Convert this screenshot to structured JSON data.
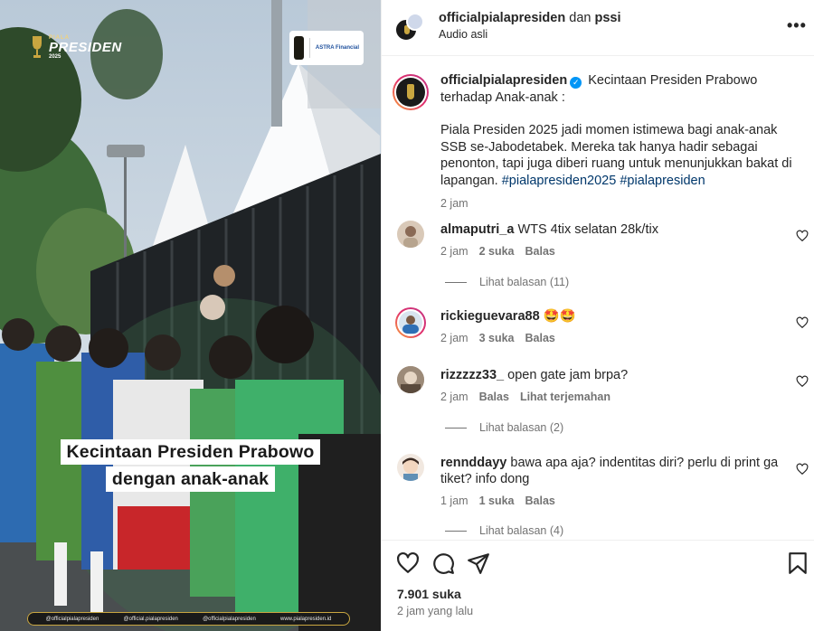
{
  "media": {
    "brand_small": "PIALA",
    "brand_big": "PRESIDEN",
    "brand_year": "2025",
    "sponsor_text": "ASTRA Financial",
    "caption_line1": "Kecintaan Presiden Prabowo",
    "caption_line2": "dengan anak-anak",
    "social": [
      "@officialpialapresiden",
      "@official.pialapresiden",
      "@officialpialapresiden",
      "www.pialapresiden.id"
    ]
  },
  "header": {
    "username": "officialpialapresiden",
    "connector": "dan",
    "collaborator": "pssi",
    "audio": "Audio asli",
    "more_label": "•••"
  },
  "post": {
    "username": "officialpialapresiden",
    "caption_lead": "Kecintaan Presiden Prabowo terhadap Anak-anak :",
    "caption_body": "Piala Presiden 2025 jadi momen istimewa bagi anak-anak SSB se-Jabodetabek. Mereka tak hanya hadir sebagai penonton, tapi juga diberi ruang untuk menunjukkan bakat di lapangan.",
    "hashtags": "#pialapresiden2025 #pialapresiden",
    "time": "2 jam"
  },
  "comments": [
    {
      "username": "almaputri_a",
      "text": "WTS 4tix selatan 28k/tix",
      "time": "2 jam",
      "likes": "2 suka",
      "reply": "Balas",
      "replies": "Lihat balasan (11)"
    },
    {
      "username": "rickieguevara88",
      "text": "🤩🤩",
      "time": "2 jam",
      "likes": "3 suka",
      "reply": "Balas"
    },
    {
      "username": "rizzzzz33_",
      "text": "open gate jam brpa?",
      "time": "2 jam",
      "reply": "Balas",
      "translate": "Lihat terjemahan",
      "replies": "Lihat balasan (2)"
    },
    {
      "username": "rennddayy",
      "text": "bawa apa aja? indentitas diri? perlu di print ga tiket? info dong",
      "time": "1 jam",
      "likes": "1 suka",
      "reply": "Balas",
      "replies": "Lihat balasan (4)"
    }
  ],
  "actions": {
    "likes": "7.901 suka",
    "time_ago": "2 jam yang lalu"
  },
  "icons": [
    "heart-icon",
    "comment-icon",
    "share-icon",
    "bookmark-icon",
    "more-icon",
    "verified-icon"
  ],
  "colors": {
    "hashtag": "#00376b",
    "meta": "#737373",
    "verified": "#0095f6"
  }
}
